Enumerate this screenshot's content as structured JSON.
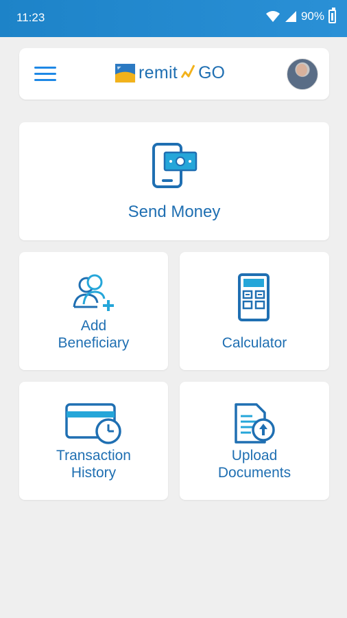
{
  "status_bar": {
    "time": "11:23",
    "battery_percent": "90%",
    "icons": [
      "wifi-icon",
      "signal-icon",
      "battery-icon"
    ]
  },
  "header": {
    "logo_text": "remit",
    "logo_go": "GO",
    "menu_icon": "hamburger-menu-icon",
    "avatar": "user-avatar"
  },
  "cards": {
    "send_money": {
      "label": "Send Money",
      "icon": "mobile-money-icon"
    },
    "add_beneficiary": {
      "label_line1": "Add",
      "label_line2": "Beneficiary",
      "icon": "add-user-icon"
    },
    "calculator": {
      "label": "Calculator",
      "icon": "calculator-icon"
    },
    "transaction_history": {
      "label_line1": "Transaction",
      "label_line2": "History",
      "icon": "card-clock-icon"
    },
    "upload_documents": {
      "label_line1": "Upload",
      "label_line2": "Documents",
      "icon": "upload-document-icon"
    }
  },
  "colors": {
    "accent": "#1f6fb2",
    "status_bar": "#1d83c8",
    "icon_teal": "#25a6d9",
    "background": "#efefef"
  }
}
